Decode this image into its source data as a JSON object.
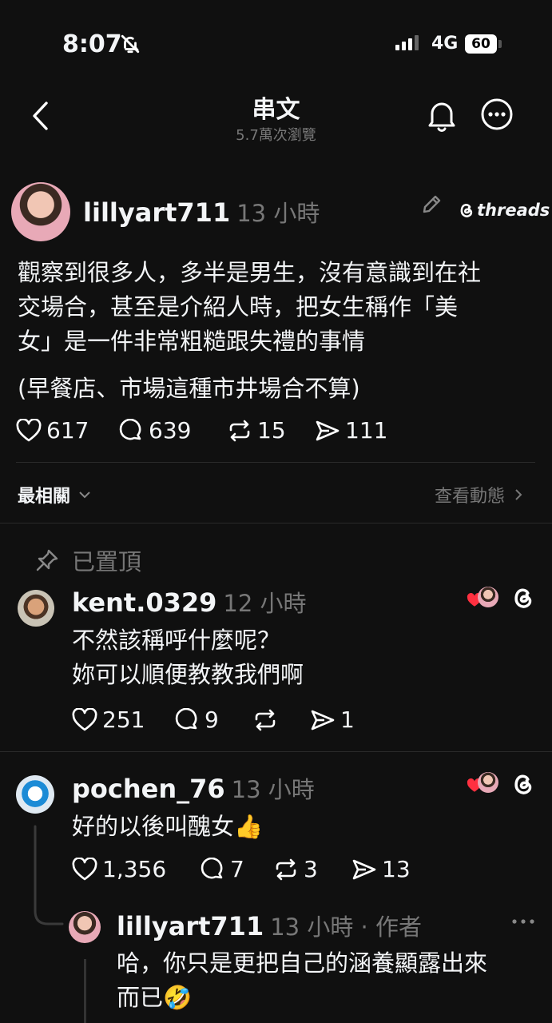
{
  "status": {
    "time": "8:07",
    "network": "4G",
    "battery": "60"
  },
  "header": {
    "title": "串文",
    "views": "5.7萬次瀏覽"
  },
  "post": {
    "username": "lillyart711",
    "time": "13 小時",
    "brand": "threads",
    "text_lines": [
      "觀察到很多人，多半是男生，沒有意識到在社",
      "交場合，甚至是介紹人時，把女生稱作「美",
      "女」是一件非常粗糙跟失禮的事情"
    ],
    "text_extra": "(早餐店、市場這種市井場合不算)",
    "likes": "617",
    "replies": "639",
    "reposts": "15",
    "shares": "111"
  },
  "sort": {
    "label": "最相關",
    "activity": "查看動態"
  },
  "pinned_label": "已置頂",
  "comments": [
    {
      "username": "kent.0329",
      "time": "12 小時",
      "lines": [
        "不然該稱呼什麼呢？",
        "妳可以順便教教我們啊"
      ],
      "likes": "251",
      "replies": "9",
      "reposts": "",
      "shares": "1"
    },
    {
      "username": "pochen_76",
      "time": "13 小時",
      "lines": [
        "好的以後叫醜女👍"
      ],
      "likes": "1,356",
      "replies": "7",
      "reposts": "3",
      "shares": "13"
    }
  ],
  "reply": {
    "username": "lillyart711",
    "time": "13 小時 · 作者",
    "lines": [
      "哈，你只是更把自己的涵養顯露出來",
      "而已🤣"
    ]
  },
  "colors": {
    "background": "#101010",
    "text": "#f3f5f7",
    "muted": "#777777",
    "heart": "#ff3040"
  }
}
